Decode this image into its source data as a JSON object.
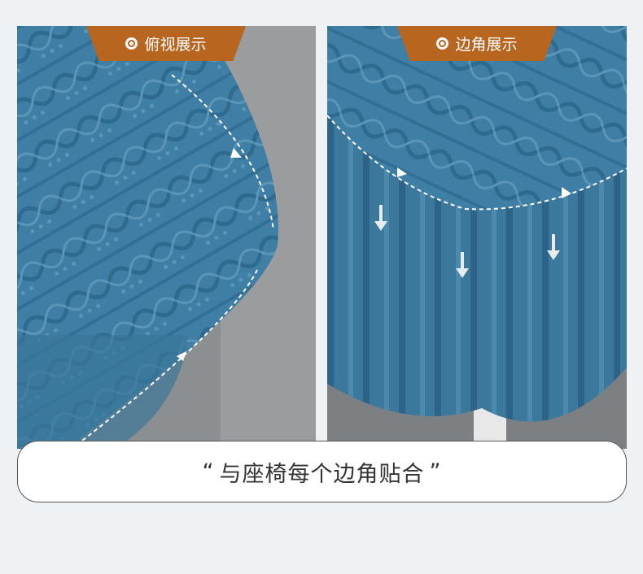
{
  "panels": [
    {
      "label": "俯视展示",
      "icon": "ring-dot-icon"
    },
    {
      "label": "边角展示",
      "icon": "ring-dot-icon"
    }
  ],
  "caption": {
    "open_quote": "“",
    "text": "与座椅每个边角贴合",
    "close_quote": "”"
  },
  "colors": {
    "background": "#eff2f5",
    "tag": "#b7651f",
    "fabric": "#3f7fa6",
    "floor": "#8a8d8f"
  }
}
